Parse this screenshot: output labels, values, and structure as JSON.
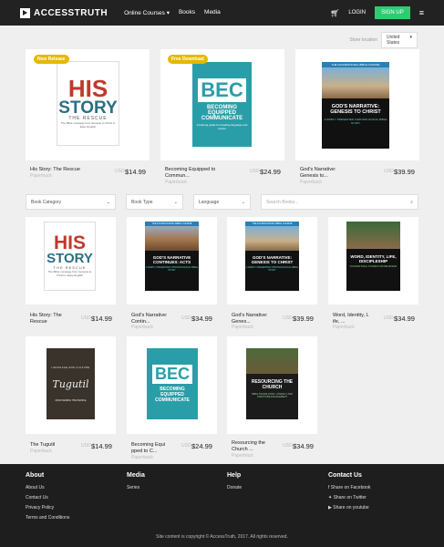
{
  "nav": {
    "brand": "ACCESSTRUTH",
    "menu": [
      "Online Courses",
      "Books",
      "Media"
    ],
    "login": "LOGIN",
    "signup": "SIGN UP"
  },
  "store": {
    "label": "Store location",
    "value": "United States"
  },
  "featured": [
    {
      "badge": "New Release",
      "title": "His Story: The Rescue",
      "format": "Paperback",
      "currency": "USD",
      "price": "$14.99"
    },
    {
      "badge": "Free Download",
      "title": "Becoming Equipped to Commun...",
      "format": "Paperback",
      "currency": "USD",
      "price": "$24.99"
    },
    {
      "badge": "",
      "title": "God's Narrative: Genesis to...",
      "format": "Paperback",
      "currency": "USD",
      "price": "$39.99"
    }
  ],
  "filters": {
    "category": "Book Category",
    "type": "Book Type",
    "language": "Language",
    "search_placeholder": "Search Books..."
  },
  "books": [
    {
      "title": "His Story: The Rescue",
      "format": "Paperback",
      "currency": "USD",
      "price": "$14.99"
    },
    {
      "title": "God's Narrative: Contin...",
      "format": "Paperback",
      "currency": "USD",
      "price": "$34.99"
    },
    {
      "title": "God's Narrative: Genes...",
      "format": "Paperback",
      "currency": "USD",
      "price": "$39.99"
    },
    {
      "title": "Word, Identity, L ife, ...",
      "format": "Paperback",
      "currency": "USD",
      "price": "$34.99"
    },
    {
      "title": "The Tugutil",
      "format": "Paperback",
      "currency": "USD",
      "price": "$14.99"
    },
    {
      "title": "Becoming Equi pped to C...",
      "format": "Paperback",
      "currency": "USD",
      "price": "$24.99"
    },
    {
      "title": "Resourcing the Church ...",
      "format": "Paperback",
      "currency": "USD",
      "price": "$34.99"
    }
  ],
  "covers": {
    "his": {
      "line1": "HIS",
      "line2": "STORY",
      "line3": "THE RESCUE",
      "tag": "The Bible message from Genesis to Christ in Easy English"
    },
    "bec": {
      "acronym": "BEC",
      "line1": "BECOMING",
      "line2": "EQUIPPED",
      "line3": "to",
      "line4": "COMMUNICATE",
      "tag": "A training guide for heading language and culture"
    },
    "gn_genesis": {
      "top": "THE FOUNDATIONAL BIBLE COURSE",
      "title": "GOD'S NARRATIVE: GENESIS TO CHRIST",
      "tag": "A SIMPLY PRESENTED CHRONOLOGICAL BIBLE STUDY"
    },
    "gn_acts": {
      "top": "THE FOUNDATIONAL BIBLE COURSE",
      "title": "GOD'S NARRATIVE CONTINUES: ACTS",
      "tag": "A SIMPLY PRESENTED CHRONOLOGICAL BIBLE STUDY"
    },
    "word": {
      "title": "WORD, IDENTITY, LIFE, DISCIPLESHIP",
      "tag": "FOUNDATIONAL STUDIES FOR BELIEVERS"
    },
    "tugutil": {
      "top": "LANGUAGE AND CULTURE",
      "title": "Tugutil",
      "tag": "DISCOVERING THE PEOPLE"
    },
    "resourcing": {
      "title": "RESOURCING THE CHURCH",
      "tag": "BIBLE TRANSLATION, LITERACY AND SCRIPTURE ENGAGEMENT"
    }
  },
  "footer": {
    "about": {
      "heading": "About",
      "links": [
        "About Us",
        "Contact Us",
        "Privacy Policy",
        "Terms and Conditions"
      ]
    },
    "media": {
      "heading": "Media",
      "links": [
        "Series"
      ]
    },
    "help": {
      "heading": "Help",
      "links": [
        "Donate"
      ]
    },
    "contact": {
      "heading": "Contact Us",
      "links": [
        "Share on Facebook",
        "Share on Twitter",
        "Share on youtube"
      ]
    },
    "copyright": "Site content is copyright © AccessTruth, 2017. All rights reserved."
  },
  "colors": {
    "nav": "#222222",
    "signup": "#2ecc71",
    "badge": "#e6b800",
    "bec": "#2a9ea8",
    "footer": "#1e1e1e"
  }
}
